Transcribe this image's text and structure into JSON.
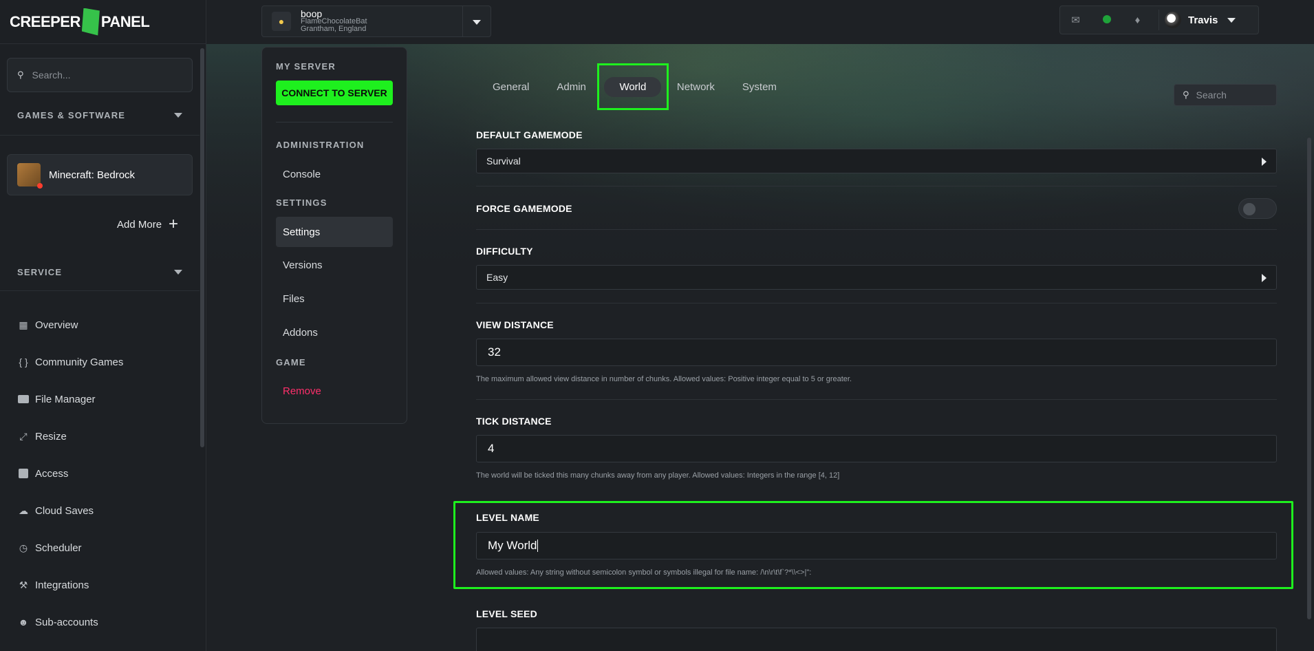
{
  "brand": {
    "logo_left": "CREEPER",
    "logo_right": "PANEL"
  },
  "sidebar": {
    "search_placeholder": "Search...",
    "games_section": "GAMES & SOFTWARE",
    "game_name": "Minecraft: Bedrock",
    "add_more": "Add More",
    "service_section": "SERVICE",
    "items": [
      {
        "label": "Overview",
        "icon": "grid-icon"
      },
      {
        "label": "Community Games",
        "icon": "braces-icon"
      },
      {
        "label": "File Manager",
        "icon": "folder-icon"
      },
      {
        "label": "Resize",
        "icon": "resize-icon"
      },
      {
        "label": "Access",
        "icon": "lock-icon"
      },
      {
        "label": "Cloud Saves",
        "icon": "cloud-icon"
      },
      {
        "label": "Scheduler",
        "icon": "clock-icon"
      },
      {
        "label": "Integrations",
        "icon": "wrench-icon"
      },
      {
        "label": "Sub-accounts",
        "icon": "users-icon"
      }
    ]
  },
  "server": {
    "name": "boop",
    "player": "FlameChocolateBat",
    "location": "Grantham, England"
  },
  "user": {
    "name": "Travis"
  },
  "subnav": {
    "my_server": "MY SERVER",
    "connect_label": "CONNECT TO SERVER",
    "administration": "ADMINISTRATION",
    "console": "Console",
    "settings_heading": "SETTINGS",
    "settings": "Settings",
    "versions": "Versions",
    "files": "Files",
    "addons": "Addons",
    "game_heading": "GAME",
    "remove": "Remove"
  },
  "tabs": [
    "General",
    "Admin",
    "World",
    "Network",
    "System"
  ],
  "search_placeholder": "Search",
  "fields": {
    "default_gamemode": {
      "label": "DEFAULT GAMEMODE",
      "value": "Survival"
    },
    "force_gamemode": {
      "label": "FORCE GAMEMODE"
    },
    "difficulty": {
      "label": "DIFFICULTY",
      "value": "Easy"
    },
    "view_distance": {
      "label": "VIEW DISTANCE",
      "value": "32",
      "hint": "The maximum allowed view distance in number of chunks. Allowed values: Positive integer equal to 5 or greater."
    },
    "tick_distance": {
      "label": "TICK DISTANCE",
      "value": "4",
      "hint": "The world will be ticked this many chunks away from any player. Allowed values: Integers in the range [4, 12]"
    },
    "level_name": {
      "label": "LEVEL NAME",
      "value": "My World",
      "hint": "Allowed values: Any string without semicolon symbol or symbols illegal for file name: /\\n\\r\\t\\f`?*\\\\<>|\":"
    },
    "level_seed": {
      "label": "LEVEL SEED"
    }
  },
  "colors": {
    "accent": "#1ef01e",
    "remove": "#ff2f6b",
    "status": "#1fa33a"
  }
}
